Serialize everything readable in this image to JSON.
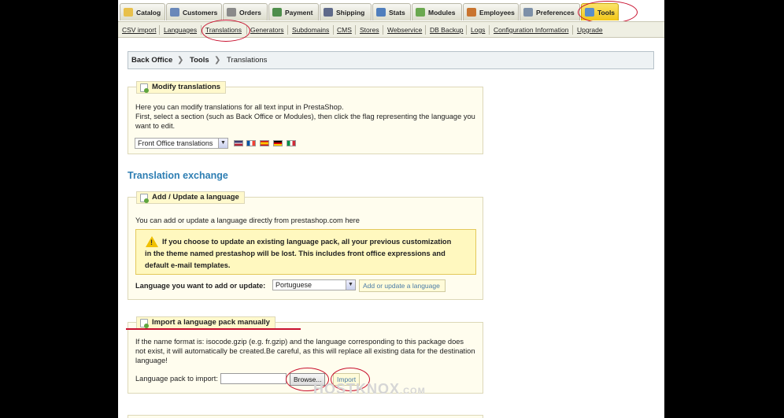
{
  "tabs": [
    {
      "label": "Catalog",
      "icon": "folder-icon",
      "color": "#e8c04b"
    },
    {
      "label": "Customers",
      "icon": "customer-icon",
      "color": "#6a88b9"
    },
    {
      "label": "Orders",
      "icon": "cart-icon",
      "color": "#8a8a8a"
    },
    {
      "label": "Payment",
      "icon": "payment-icon",
      "color": "#4e8e4b"
    },
    {
      "label": "Shipping",
      "icon": "truck-icon",
      "color": "#5f6a8a"
    },
    {
      "label": "Stats",
      "icon": "stats-icon",
      "color": "#4f7ebd"
    },
    {
      "label": "Modules",
      "icon": "puzzle-icon",
      "color": "#6aa84f"
    },
    {
      "label": "Employees",
      "icon": "employee-icon",
      "color": "#c9742f"
    },
    {
      "label": "Preferences",
      "icon": "preferences-icon",
      "color": "#7d90a8"
    },
    {
      "label": "Tools",
      "icon": "wrench-icon",
      "color": "#5b8ec9",
      "active": true
    }
  ],
  "subnav": [
    "CSV import",
    "Languages",
    "Translations",
    "Generators",
    "Subdomains",
    "CMS",
    "Stores",
    "Webservice",
    "DB Backup",
    "Logs",
    "Configuration Information",
    "Upgrade"
  ],
  "breadcrumb": {
    "root": "Back Office",
    "section": "Tools",
    "current": "Translations"
  },
  "modify": {
    "legend": "Modify translations",
    "line1": "Here you can modify translations for all text input in PrestaShop.",
    "line2": "First, select a section (such as Back Office or Modules), then click the flag representing the language you",
    "line3": "want to edit.",
    "select_value": "Front Office translations",
    "flags": [
      "en",
      "fr",
      "es",
      "de",
      "it"
    ]
  },
  "exchange_title": "Translation exchange",
  "add": {
    "legend": "Add / Update a language",
    "intro": "You can add or update a language directly from prestashop.com here",
    "warning_l1": "If you choose to update an existing language pack, all your previous customization",
    "warning_l2": "in the theme named prestashop will be lost. This includes front office expressions and",
    "warning_l3": "default e-mail templates.",
    "label": "Language you want to add or update:",
    "select_value": "Portuguese",
    "button": "Add or update a language"
  },
  "import": {
    "legend": "Import a language pack manually",
    "l1": "If the name format is: isocode.gzip (e.g. fr.gzip) and the language corresponding to this package does",
    "l2": "not exist, it will automatically be created.Be careful, as this will replace all existing data for the destination",
    "l3": "language!",
    "label": "Language pack to import:",
    "browse": "Browse...",
    "import_button": "Import"
  },
  "watermark": {
    "main": "HOSTKNOX",
    "suffix": ".COM"
  },
  "colors": {
    "accent_title": "#2e7eb3",
    "highlight_red": "#c8102e",
    "active_tab": "#f2c619"
  }
}
